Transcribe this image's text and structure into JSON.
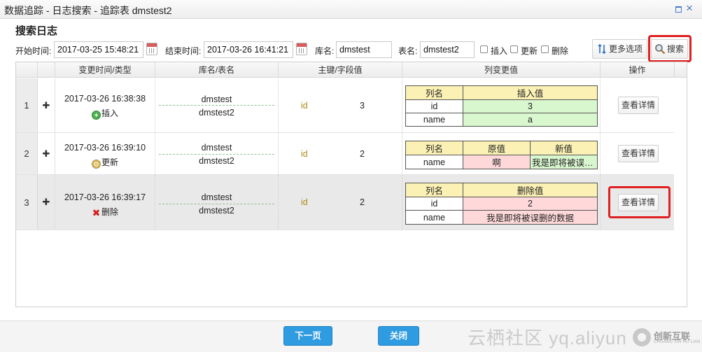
{
  "window": {
    "title": "数据追踪 - 日志搜索 - 追踪表 dmstest2",
    "maximize_icon": "maximize-icon",
    "close_icon": "close-icon",
    "close_glyph": "×"
  },
  "section_title": "搜索日志",
  "filters": {
    "start_label": "开始时间:",
    "start_value": "2017-03-25 15:48:21",
    "end_label": "结束时间:",
    "end_value": "2017-03-26 16:41:21",
    "db_label": "库名:",
    "db_value": "dmstest",
    "table_label": "表名:",
    "table_value": "dmstest2",
    "insert_label": "插入",
    "update_label": "更新",
    "delete_label": "删除",
    "insert_checked": false,
    "update_checked": false,
    "delete_checked": false
  },
  "toolbar": {
    "more_options_label": "更多选项",
    "search_label": "搜索",
    "more_options_icon": "sort-arrows-icon",
    "search_icon": "magnifier-icon"
  },
  "table": {
    "columns": [
      "变更时间/类型",
      "库名/表名",
      "主键/字段值",
      "列变更值",
      "操作"
    ],
    "rows": [
      {
        "num": "1",
        "time": "2017-03-26 16:38:38",
        "op_type": "插入",
        "op_icon": "insert-icon",
        "db": "dmstest",
        "table": "dmstest2",
        "key": "id",
        "key_value": "3",
        "change": {
          "headers": [
            "列名",
            "插入值"
          ],
          "rows": [
            [
              "id",
              "3"
            ],
            [
              "name",
              "a"
            ]
          ]
        },
        "action": "查看详情"
      },
      {
        "num": "2",
        "time": "2017-03-26 16:39:10",
        "op_type": "更新",
        "op_icon": "update-gear-icon",
        "db": "dmstest",
        "table": "dmstest2",
        "key": "id",
        "key_value": "2",
        "change": {
          "headers": [
            "列名",
            "原值",
            "新值"
          ],
          "rows": [
            [
              "name",
              "啊",
              "我是即将被误删..."
            ]
          ]
        },
        "action": "查看详情"
      },
      {
        "num": "3",
        "time": "2017-03-26 16:39:17",
        "op_type": "删除",
        "op_icon": "delete-x-icon",
        "db": "dmstest",
        "table": "dmstest2",
        "key": "id",
        "key_value": "2",
        "change": {
          "headers": [
            "列名",
            "删除值"
          ],
          "rows": [
            [
              "id",
              "2"
            ],
            [
              "name",
              "我是即将被误删的数据"
            ]
          ]
        },
        "action": "查看详情"
      }
    ]
  },
  "footer": {
    "next_label": "下一页",
    "close_label": "关闭",
    "watermark_text": "云栖社区 yq.aliyun",
    "watermark_logo": "创新互联",
    "watermark_logo_sub": "CHUANG XIN HU LIAN"
  },
  "colors": {
    "highlight": "#e02020",
    "primary_button": "#2f9be0",
    "insert_cell": "#d9f7cf",
    "delete_cell": "#ffd9d9",
    "header_cell": "#fbf1b4"
  }
}
